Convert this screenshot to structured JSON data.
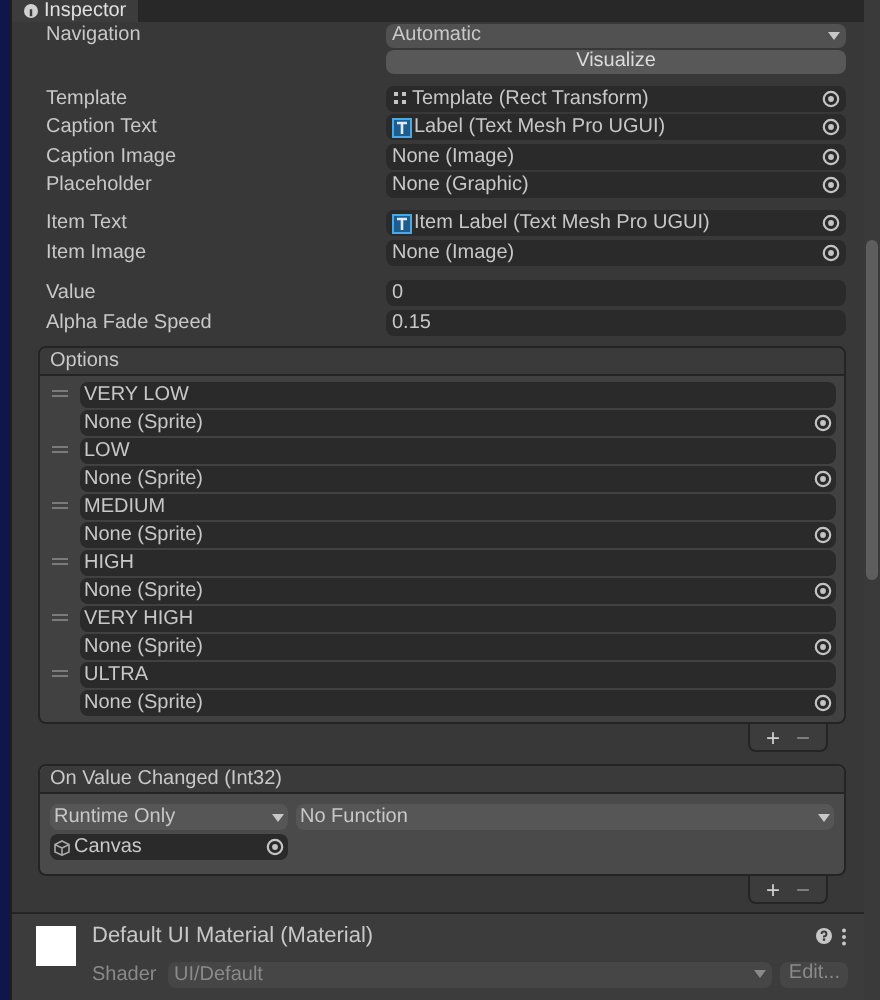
{
  "tab": {
    "title": "Inspector"
  },
  "navigation": {
    "label": "Navigation",
    "value": "Automatic"
  },
  "visualize_button": "Visualize",
  "field_groups": [
    [
      {
        "label": "Template",
        "value": "Template (Rect Transform)",
        "kind": "rect"
      },
      {
        "label": "Caption Text",
        "value": "Label (Text Mesh Pro UGUI)",
        "kind": "text"
      },
      {
        "label": "Caption Image",
        "value": "None (Image)"
      },
      {
        "label": "Placeholder",
        "value": "None (Graphic)"
      }
    ],
    [
      {
        "label": "Item Text",
        "value": "Item Label (Text Mesh Pro UGUI)",
        "kind": "text"
      },
      {
        "label": "Item Image",
        "value": "None (Image)"
      }
    ]
  ],
  "value_fields": [
    {
      "label": "Value",
      "value": "0"
    },
    {
      "label": "Alpha Fade Speed",
      "value": "0.15"
    }
  ],
  "options": {
    "title": "Options",
    "items": [
      {
        "text": "VERY LOW",
        "sprite": "None (Sprite)"
      },
      {
        "text": "LOW",
        "sprite": "None (Sprite)"
      },
      {
        "text": "MEDIUM",
        "sprite": "None (Sprite)"
      },
      {
        "text": "HIGH",
        "sprite": "None (Sprite)"
      },
      {
        "text": "VERY HIGH",
        "sprite": "None (Sprite)"
      },
      {
        "text": "ULTRA",
        "sprite": "None (Sprite)"
      }
    ],
    "add": "+",
    "remove": "−"
  },
  "event": {
    "title": "On Value Changed (Int32)",
    "mode": "Runtime Only",
    "function": "No Function",
    "target": "Canvas",
    "add": "+",
    "remove": "−"
  },
  "material": {
    "name": "Default UI Material (Material)",
    "shader_label": "Shader",
    "shader": "UI/Default",
    "edit": "Edit..."
  }
}
